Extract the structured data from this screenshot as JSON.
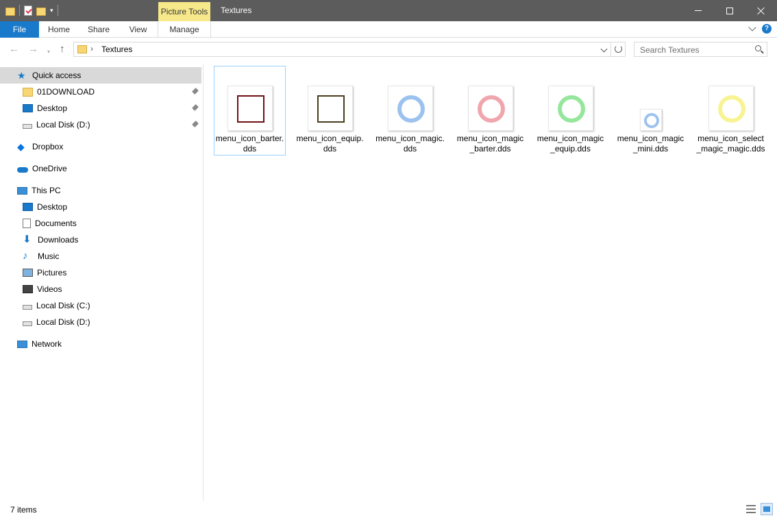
{
  "window": {
    "title": "Textures",
    "contextual_tab": "Picture Tools"
  },
  "ribbon": {
    "tabs": [
      {
        "label": "File"
      },
      {
        "label": "Home"
      },
      {
        "label": "Share"
      },
      {
        "label": "View"
      },
      {
        "label": "Manage"
      }
    ],
    "help_label": "?"
  },
  "address": {
    "separator": "›",
    "path": "Textures"
  },
  "search": {
    "placeholder": "Search Textures"
  },
  "navpane": {
    "items": [
      {
        "label": "Quick access",
        "icon": "star-icon",
        "pinned": false
      },
      {
        "label": "01DOWNLOAD",
        "icon": "folder-icon",
        "pinned": true
      },
      {
        "label": "Desktop",
        "icon": "desktop-icon",
        "pinned": true
      },
      {
        "label": "Local Disk (D:)",
        "icon": "disk-icon",
        "pinned": true
      },
      {
        "label": "Dropbox",
        "icon": "dropbox-icon",
        "pinned": false
      },
      {
        "label": "OneDrive",
        "icon": "onedrive-icon",
        "pinned": false
      },
      {
        "label": "This PC",
        "icon": "this-pc-icon",
        "pinned": false
      },
      {
        "label": "Desktop",
        "icon": "desktop-icon",
        "pinned": false
      },
      {
        "label": "Documents",
        "icon": "documents-icon",
        "pinned": false
      },
      {
        "label": "Downloads",
        "icon": "downloads-icon",
        "pinned": false
      },
      {
        "label": "Music",
        "icon": "music-icon",
        "pinned": false
      },
      {
        "label": "Pictures",
        "icon": "pictures-icon",
        "pinned": false
      },
      {
        "label": "Videos",
        "icon": "videos-icon",
        "pinned": false
      },
      {
        "label": "Local Disk (C:)",
        "icon": "windows-disk-icon",
        "pinned": false
      },
      {
        "label": "Local Disk (D:)",
        "icon": "disk-icon",
        "pinned": false
      },
      {
        "label": "Network",
        "icon": "network-icon",
        "pinned": false
      }
    ]
  },
  "files": [
    {
      "name": "menu_icon_barter.dds",
      "thumb": "square",
      "color": "#6b0f12",
      "selected": true
    },
    {
      "name": "menu_icon_equip.dds",
      "thumb": "square",
      "color": "#4a3b1c",
      "selected": false
    },
    {
      "name": "menu_icon_magic.dds",
      "thumb": "ring",
      "color": "#4a90e2",
      "selected": false
    },
    {
      "name": "menu_icon_magic_barter.dds",
      "thumb": "ring",
      "color": "#e35d6a",
      "selected": false
    },
    {
      "name": "menu_icon_magic_equip.dds",
      "thumb": "ring",
      "color": "#3fd14a",
      "selected": false
    },
    {
      "name": "menu_icon_magic_mini.dds",
      "thumb": "ring-mini",
      "color": "#4a90e2",
      "selected": false
    },
    {
      "name": "menu_icon_select_magic_magic.dds",
      "thumb": "ring",
      "color": "#f2ea3a",
      "selected": false
    }
  ],
  "status": {
    "item_count": "7 items"
  },
  "colors": {
    "titlebar": "#5c5c5c",
    "accent": "#1979ca",
    "contextual_tab": "#f6e88b"
  }
}
